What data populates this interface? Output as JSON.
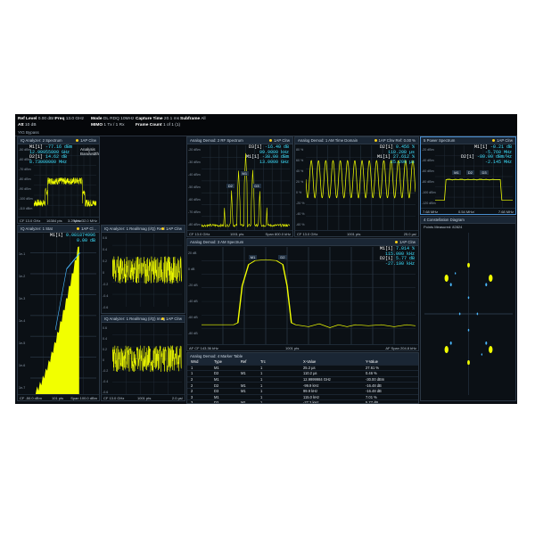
{
  "topbar": {
    "ref_level_label": "Ref Level",
    "ref_level": "0.00 dBm",
    "freq_label": "Freq",
    "freq": "13.0 GHz",
    "mode_label": "Mode",
    "mode": "DL RDQ",
    "mode2": "10MHz",
    "capture_label": "Capture Time",
    "capture": "20.1 ms",
    "subframe_label": "Subframe",
    "subframe": "All",
    "att_label": "Att",
    "att": "10 dB",
    "mimo_label": "MIMO",
    "mimo": "1 Tx / 1 Rx",
    "frame_label": "Frame Count",
    "frame": "1 of 1 (1)",
    "yig": "YIG Bypass"
  },
  "p1": {
    "title": "IQ Analyzer: 2 Spectrum",
    "trace": "1AP Clrw",
    "bw": "Analysis Bandwidth",
    "m1_label": "M1[1]",
    "m1_a": "-77.16 dBm",
    "m1_b": "12.99955000 GHz",
    "d2_label": "D2[1]",
    "d2_a": "14.62 dB",
    "d2_b": "8.73000000 MHz",
    "yticks": [
      "-50 dBm",
      "-60 dBm",
      "-70 dBm",
      "-80 dBm",
      "-90 dBm",
      "-100 dBm",
      "-110 dBm"
    ],
    "foot_l": "CF 13.0 GHz",
    "foot_m": "16384 pts",
    "foot_m2": "3.2 MHz/",
    "foot_r": "Span 32.0 MHz"
  },
  "p2": {
    "title": "Analog Demod: 2 RF Spectrum",
    "trace": "1AP Clrw",
    "d3_label": "D3[1]",
    "d3_a": "-16.40 dB",
    "d3_b": "99.9000 kHz",
    "m1_label": "M1[1]",
    "m1_a": "-38.00 dBm",
    "m1_b": "13.0000 GHz",
    "yticks": [
      "-20 dBm",
      "-30 dBm",
      "-40 dBm",
      "-50 dBm",
      "-60 dBm",
      "-70 dBm",
      "-80 dBm"
    ],
    "markers": [
      "M1",
      "D2",
      "D3"
    ],
    "foot_l": "CF 13.0 GHz",
    "foot_m": "1001 pts",
    "foot_r": "Span 800.0 kHz"
  },
  "p3": {
    "title": "Analog Demod: 1 AM Time Domain",
    "trace": "1AP Clrw",
    "ref": "Ref: 0.00 %",
    "d2_label": "D2[1]",
    "d2_a": "0.456 %",
    "d2_b": "110.200 µs",
    "m1_label": "M1[1]",
    "m1_a": "27.612 %",
    "m1_b": "25.200 µs",
    "yticks": [
      "80 %",
      "60 %",
      "40 %",
      "20 %",
      "0 %",
      "-20 %",
      "-40 %",
      "-60 %"
    ],
    "foot_l": "CF 13.0 GHz",
    "foot_m": "1001 pts",
    "foot_r": "25.0 µs/"
  },
  "p4": {
    "title": "5 Power Spectrum",
    "trace": "1AP Clrw",
    "m1_label": "M1[1]",
    "m1_a": "-0.21 dB",
    "m1_b": "-5.760 MHz",
    "d2_label": "D2[1]",
    "d2_a": "-80.00 dBm/Hz",
    "d2_b": "-2.145 MHz",
    "yticks": [
      "-20 dBm",
      "-40 dBm",
      "-60 dBm",
      "-80 dBm",
      "-100 dBm",
      "-120 dBm"
    ],
    "markers": [
      "M1",
      "D2",
      "D3"
    ],
    "foot_l": "7.68 MHz",
    "foot_m": "0.54 MHz/",
    "foot_r": "7.68 MHz"
  },
  "p5": {
    "title": "IQ Analyzer: 1 Stat",
    "trace": "1AP Cl...",
    "m1_label": "M1[1]",
    "m1_a": "0.081874996",
    "m1_b": "0.00 dB",
    "yticks": [
      "1e-1",
      "1e-2",
      "1e-3",
      "1e-4",
      "1e-5",
      "1e-6",
      "1e-7"
    ],
    "foot_l": "CF -50.0 dBm",
    "foot_m": "101 pts",
    "foot_r": "Span 100.0 dBm"
  },
  "p6": {
    "title": "IQ Analyzer: 1 Real/Imag (I/Q) Real",
    "trace": "1AP Clrw",
    "yticks": [
      "0.6",
      "0.4",
      "0.2",
      "0",
      "-0.2",
      "-0.4",
      "-0.6"
    ]
  },
  "p7": {
    "title": "IQ Analyzer: 1 Real/Imag (I/Q) Imag",
    "trace": "1AP Clrw",
    "yticks": [
      "0.6",
      "0.4",
      "0.2",
      "0",
      "-0.2",
      "-0.4",
      "-0.6"
    ],
    "foot_l": "CF 13.0 GHz",
    "foot_m": "1001 pts",
    "foot_r": "2.0 µs/"
  },
  "p8": {
    "title": "Analog Demod: 3 AM Spectrum",
    "trace": "1AP Clrw",
    "m1_label": "M1[1]",
    "m1_a": "7.014 %",
    "m1_b": "115.000 kHz",
    "d2_label": "D2[1]",
    "d2_a": "5.77 dB",
    "d2_b": "-27.190 kHz",
    "yticks": [
      "20 dB",
      "0 dB",
      "-20 dB",
      "-40 dB",
      "-60 dB",
      "-80 dB"
    ],
    "markers": [
      "M1",
      "D2"
    ],
    "foot_l": "AF CF 143.36 kHz",
    "foot_m": "1001 pts",
    "foot_r": "AF Span 204.8 kHz"
  },
  "p9": {
    "title": "Analog Demod: 4 Marker Table",
    "headers": [
      "Wnd",
      "Type",
      "Ref",
      "Trc",
      "X-Value",
      "Y-Value"
    ],
    "rows": [
      [
        "1",
        "M1",
        "",
        "1",
        "25.2 µs",
        "27.61 %"
      ],
      [
        "1",
        "D2",
        "M1",
        "1",
        "110.2 µs",
        "0.46 %"
      ],
      [
        "2",
        "M1",
        "",
        "1",
        "12.9999984 GHz",
        "-30.00 dBm"
      ],
      [
        "2",
        "D2",
        "M1",
        "1",
        "-99.9 kHz",
        "-16.48 dB"
      ],
      [
        "2",
        "D3",
        "M1",
        "1",
        "99.9 kHz",
        "-16.48 dB"
      ],
      [
        "3",
        "M1",
        "",
        "1",
        "115.0 kHz",
        "7.01 %"
      ],
      [
        "3",
        "D2",
        "M1",
        "1",
        "-27.2 kHz",
        "5.77 dB"
      ],
      [
        "4",
        "M1",
        "",
        "1",
        "-5.8 MHz",
        "-0.21 dB"
      ]
    ]
  },
  "p10": {
    "title": "4 Constellation Diagram",
    "info": "Points Measured: 82824"
  }
}
